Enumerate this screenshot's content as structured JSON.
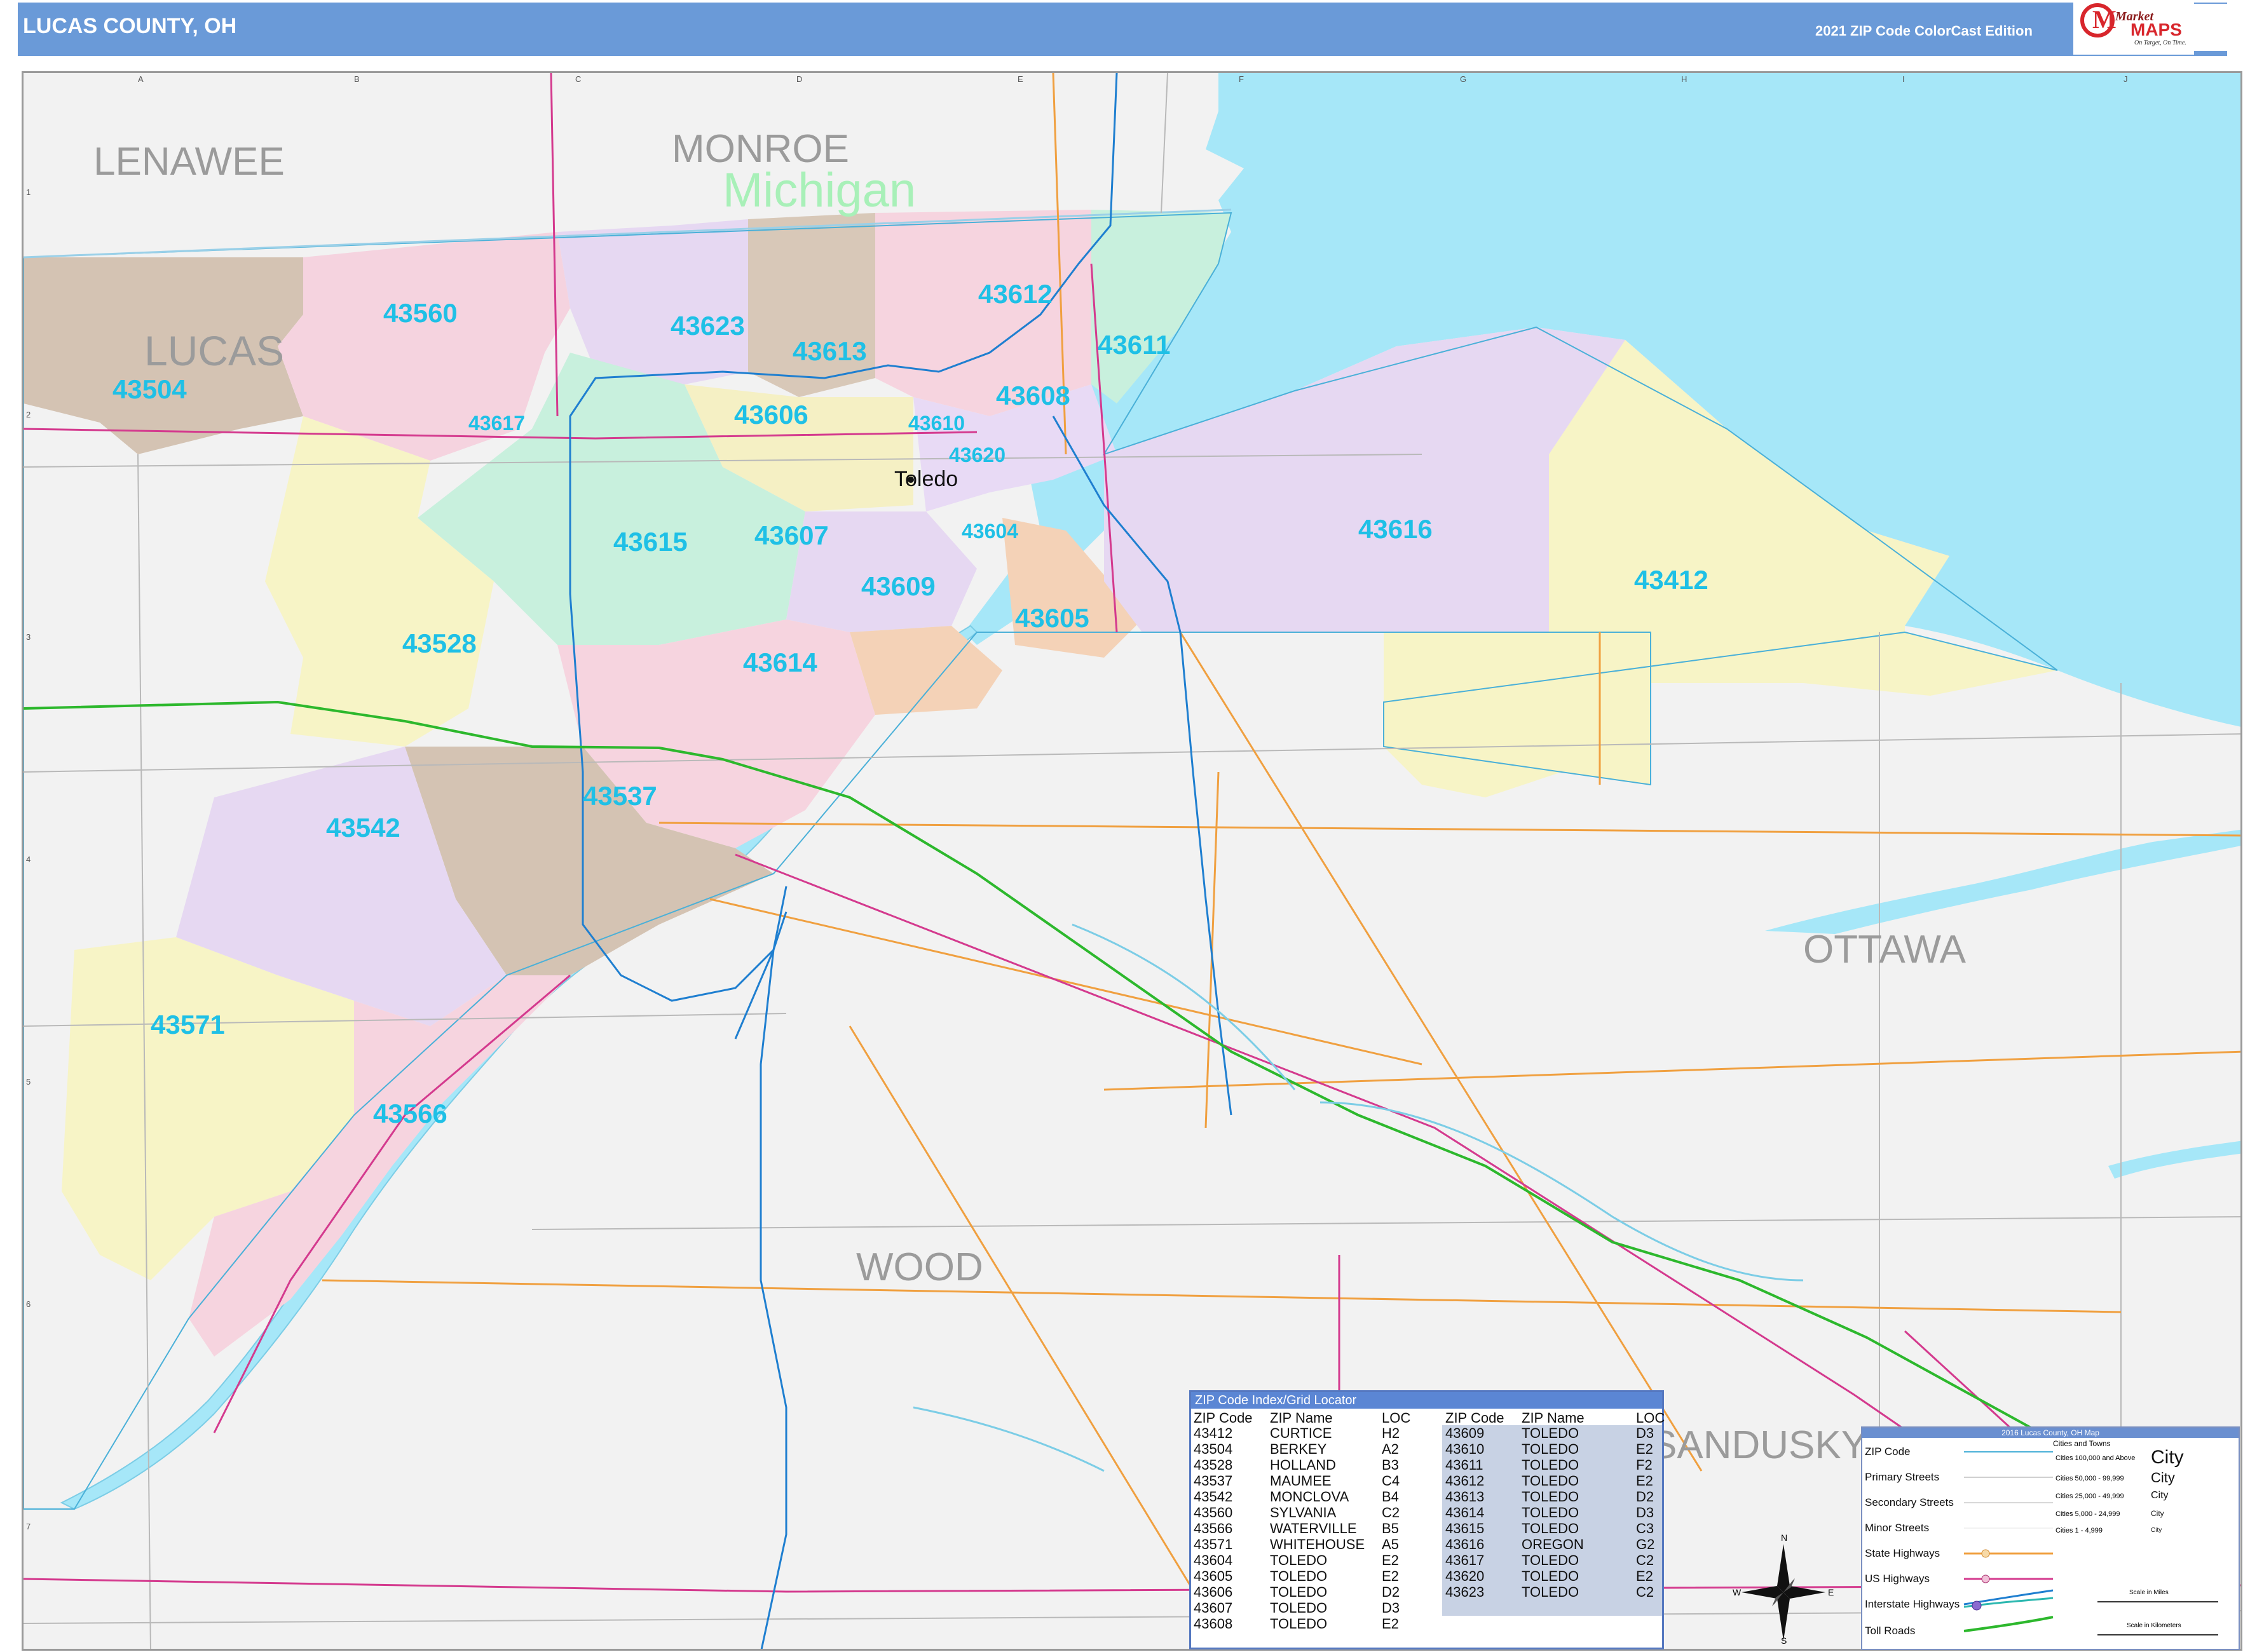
{
  "header": {
    "title": "LUCAS COUNTY, OH",
    "edition": "2021 ZIP Code ColorCast Edition",
    "logo_brand": "MAPS",
    "logo_prefix": "Market",
    "logo_tagline": "On Target, On Time.",
    "colors": {
      "bar": "#6a9ad8",
      "logo_red": "#d8262c"
    }
  },
  "grid": {
    "columns": [
      "A",
      "B",
      "C",
      "D",
      "E",
      "F",
      "G",
      "H",
      "I",
      "J"
    ],
    "rows": [
      "1",
      "2",
      "3",
      "4",
      "5",
      "6",
      "7"
    ]
  },
  "map": {
    "counties": [
      "LENAWEE",
      "MONROE",
      "LUCAS",
      "OTTAWA",
      "WOOD",
      "SANDUSKY"
    ],
    "state_label": "Michigan",
    "city_label": "Toledo",
    "zip_labels": [
      "43560",
      "43623",
      "43613",
      "43612",
      "43611",
      "43504",
      "43617",
      "43606",
      "43610",
      "43608",
      "43620",
      "43615",
      "43607",
      "43604",
      "43616",
      "43412",
      "43609",
      "43605",
      "43528",
      "43614",
      "43537",
      "43542",
      "43571",
      "43566"
    ],
    "colors": {
      "water": "#a6e7f8",
      "land": "#f2f2f2",
      "zip_text": "#1fc0e6",
      "county_text": "#9b9b9b",
      "state_text": "#a8f0b8",
      "toll_road": "#2db82d",
      "interstate": "#1f7fd0",
      "us_highway": "#d43a8e",
      "state_highway": "#f0a040"
    }
  },
  "index": {
    "title": "ZIP Code Index/Grid Locator",
    "columns": [
      "ZIP Code",
      "ZIP Name",
      "LOC"
    ],
    "rows_left": [
      [
        "43412",
        "CURTICE",
        "H2"
      ],
      [
        "43504",
        "BERKEY",
        "A2"
      ],
      [
        "43528",
        "HOLLAND",
        "B3"
      ],
      [
        "43537",
        "MAUMEE",
        "C4"
      ],
      [
        "43542",
        "MONCLOVA",
        "B4"
      ],
      [
        "43560",
        "SYLVANIA",
        "C2"
      ],
      [
        "43566",
        "WATERVILLE",
        "B5"
      ],
      [
        "43571",
        "WHITEHOUSE",
        "A5"
      ],
      [
        "43604",
        "TOLEDO",
        "E2"
      ],
      [
        "43605",
        "TOLEDO",
        "E2"
      ],
      [
        "43606",
        "TOLEDO",
        "D2"
      ],
      [
        "43607",
        "TOLEDO",
        "D3"
      ],
      [
        "43608",
        "TOLEDO",
        "E2"
      ]
    ],
    "rows_right": [
      [
        "43609",
        "TOLEDO",
        "D3"
      ],
      [
        "43610",
        "TOLEDO",
        "E2"
      ],
      [
        "43611",
        "TOLEDO",
        "F2"
      ],
      [
        "43612",
        "TOLEDO",
        "E2"
      ],
      [
        "43613",
        "TOLEDO",
        "D2"
      ],
      [
        "43614",
        "TOLEDO",
        "D3"
      ],
      [
        "43615",
        "TOLEDO",
        "C3"
      ],
      [
        "43616",
        "OREGON",
        "G2"
      ],
      [
        "43617",
        "TOLEDO",
        "C2"
      ],
      [
        "43620",
        "TOLEDO",
        "E2"
      ],
      [
        "43623",
        "TOLEDO",
        "C2"
      ]
    ]
  },
  "legend": {
    "title": "2016 Lucas County, OH Map",
    "items": [
      "ZIP Code",
      "Primary Streets",
      "Secondary Streets",
      "Minor Streets",
      "State Highways",
      "US Highways",
      "Interstate Highways",
      "Toll Roads"
    ],
    "cities_header": "Cities and Towns",
    "city_sizes": [
      {
        "range": "Cities 100,000 and Above",
        "sample": "City"
      },
      {
        "range": "Cities 50,000 - 99,999",
        "sample": "City"
      },
      {
        "range": "Cities 25,000 - 49,999",
        "sample": "City"
      },
      {
        "range": "Cities 5,000 - 24,999",
        "sample": "City"
      },
      {
        "range": "Cities 1 - 4,999",
        "sample": "City"
      }
    ],
    "scale_miles": "Scale in Miles",
    "scale_km": "Scale in Kilometers",
    "compass": {
      "n": "N",
      "s": "S",
      "e": "E",
      "w": "W"
    }
  }
}
